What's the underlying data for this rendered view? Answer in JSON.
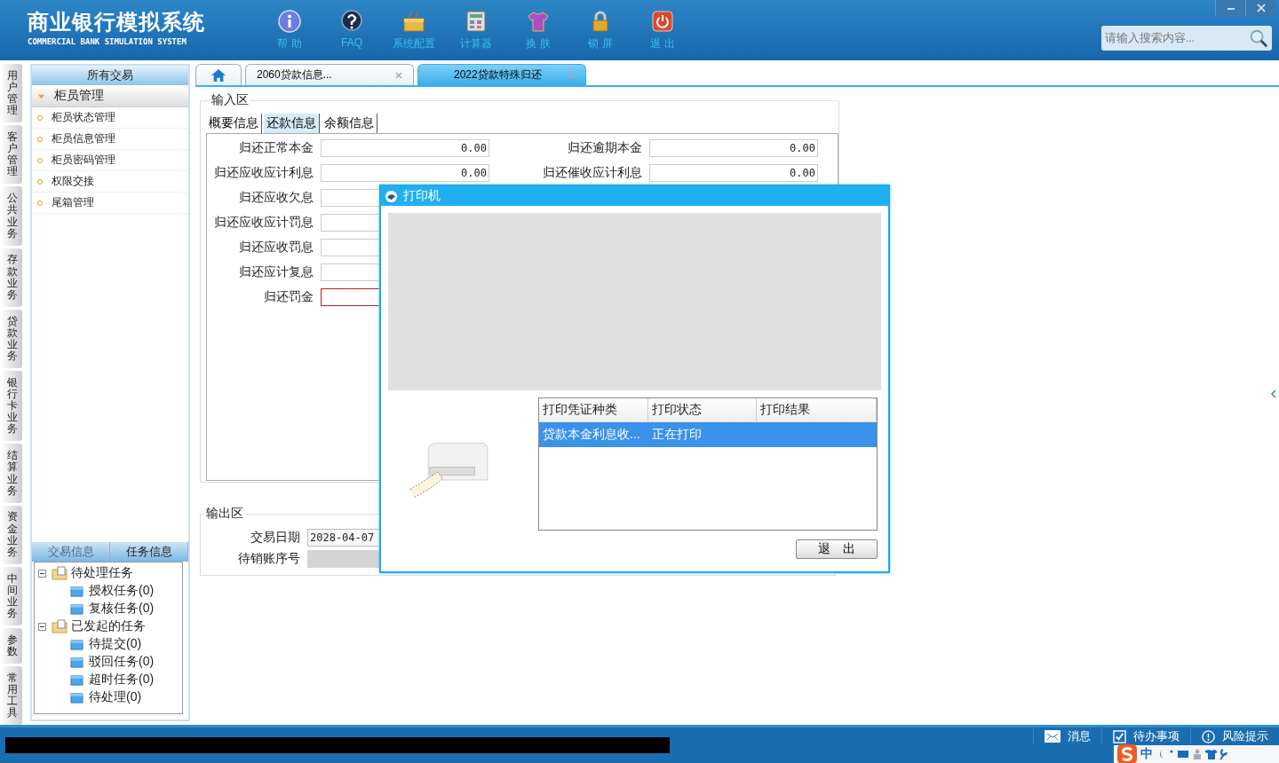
{
  "app": {
    "title": "商业银行模拟系统",
    "subtitle": "COMMERCIAL BANK SIMULATION SYSTEM"
  },
  "toolbar": [
    {
      "kind": "help",
      "label": "帮 助"
    },
    {
      "kind": "faq",
      "label": "FAQ"
    },
    {
      "kind": "config",
      "label": "系统配置"
    },
    {
      "kind": "calculator",
      "label": "计算器"
    },
    {
      "kind": "skin",
      "label": "换 肤"
    },
    {
      "kind": "lock",
      "label": "锁 屏"
    },
    {
      "kind": "exit",
      "label": "退 出"
    }
  ],
  "search": {
    "placeholder": "请输入搜索内容..."
  },
  "side_tabs": [
    "用户管理",
    "客户管理",
    "公共业务",
    "存款业务",
    "贷款业务",
    "银行卡业务",
    "结算业务",
    "资金业务",
    "中间业务",
    "参数",
    "常用工具"
  ],
  "sidebar": {
    "header": "所有交易",
    "group": {
      "label": "柜员管理",
      "expanded": true,
      "items": [
        "柜员状态管理",
        "柜员信息管理",
        "柜员密码管理",
        "权限交接",
        "尾箱管理"
      ]
    }
  },
  "info_tabs": [
    {
      "label": "交易信息",
      "selected": false
    },
    {
      "label": "任务信息",
      "selected": true
    }
  ],
  "task_tree": [
    {
      "label": "待处理任务",
      "expanded": true,
      "children": [
        {
          "label": "授权任务(0)"
        },
        {
          "label": "复核任务(0)"
        }
      ]
    },
    {
      "label": "已发起的任务",
      "expanded": true,
      "children": [
        {
          "label": "待提交(0)"
        },
        {
          "label": "驳回任务(0)"
        },
        {
          "label": "超时任务(0)"
        },
        {
          "label": "待处理(0)"
        }
      ]
    }
  ],
  "tabs": [
    {
      "kind": "home",
      "selected": false
    },
    {
      "kind": "page",
      "label": "2060贷款信息...",
      "selected": false
    },
    {
      "kind": "page",
      "label": "2022贷款特殊归还",
      "selected": true
    }
  ],
  "input_area": {
    "title": "输入区",
    "tabs": [
      {
        "label": "概要信息",
        "selected": false
      },
      {
        "label": "还款信息",
        "selected": true
      },
      {
        "label": "余额信息",
        "selected": false
      }
    ],
    "left_fields": [
      {
        "label": "归还正常本金",
        "value": "0.00",
        "invalid": false
      },
      {
        "label": "归还应收应计利息",
        "value": "0.00",
        "invalid": false
      },
      {
        "label": "归还应收欠息",
        "invalid": false
      },
      {
        "label": "归还应收应计罚息",
        "invalid": false
      },
      {
        "label": "归还应收罚息",
        "invalid": false
      },
      {
        "label": "归还应计复息",
        "invalid": false
      },
      {
        "label": "归还罚金",
        "invalid": true
      }
    ],
    "right_fields": [
      {
        "label": "归还逾期本金",
        "value": "0.00"
      },
      {
        "label": "归还催收应计利息",
        "value": "0.00"
      }
    ]
  },
  "output_area": {
    "title": "输出区",
    "fields": [
      {
        "label": "交易日期",
        "value": "2028-04-07",
        "disabled": false
      },
      {
        "label": "待销账序号",
        "disabled": true
      }
    ]
  },
  "dialog": {
    "title": "打印机",
    "columns": [
      "打印凭证种类",
      "打印状态",
      "打印结果"
    ],
    "rows": [
      {
        "cells": [
          "贷款本金利息收...",
          "正在打印",
          ""
        ],
        "selected": true
      }
    ],
    "button": "退　出"
  },
  "status_bar": {
    "items": [
      {
        "kind": "message",
        "label": "消息"
      },
      {
        "kind": "todo",
        "label": "待办事项"
      },
      {
        "kind": "risk",
        "label": "风险提示"
      }
    ],
    "ime": {
      "label": "中"
    }
  }
}
